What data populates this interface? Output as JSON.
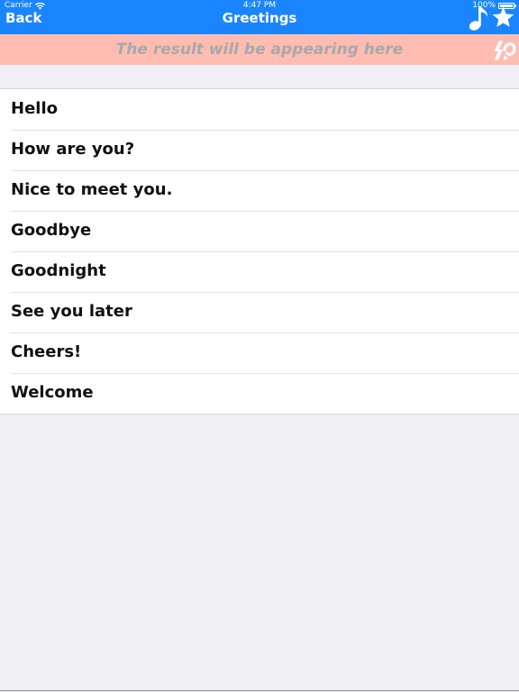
{
  "status_bar": {
    "carrier": "Carrier",
    "time": "4:47 PM",
    "battery": "100%"
  },
  "nav": {
    "back_label": "Back",
    "title": "Greetings",
    "right_icons": [
      "music-note-icon",
      "star-icon"
    ]
  },
  "result": {
    "text": "The result will be appearing here",
    "icon": "translate-icon"
  },
  "phrases": [
    "Hello",
    "How are you?",
    "Nice to meet you.",
    "Goodbye",
    "Goodnight",
    "See you later",
    "Cheers!",
    "Welcome"
  ],
  "colors": {
    "nav_background": "#1a85ff",
    "result_background": "#ffbcb0",
    "result_text": "#a8a8ad",
    "page_background": "#efeff4"
  }
}
